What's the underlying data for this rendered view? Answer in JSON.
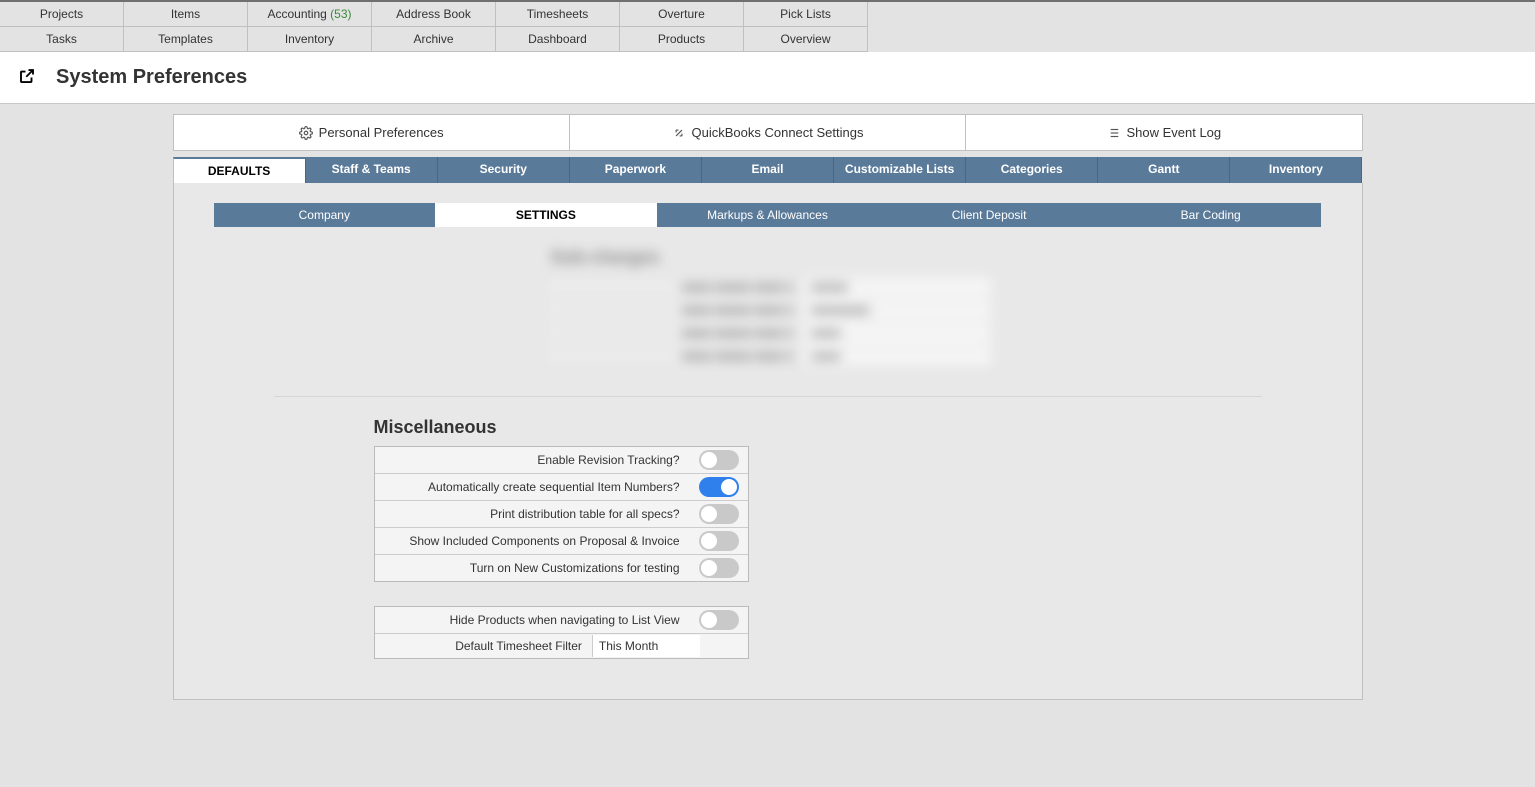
{
  "nav": {
    "row1": [
      "Projects",
      "Items",
      "Accounting",
      "Address Book",
      "Timesheets",
      "Overture",
      "Pick Lists"
    ],
    "row1_badge_index": 2,
    "row1_badge": "(53)",
    "row2": [
      "Tasks",
      "Templates",
      "Inventory",
      "Archive",
      "Dashboard",
      "Products",
      "Overview"
    ]
  },
  "page_title": "System Preferences",
  "top_buttons": {
    "personal": "Personal Preferences",
    "qb": "QuickBooks Connect Settings",
    "eventlog": "Show Event Log"
  },
  "primary_tabs": [
    "DEFAULTS",
    "Staff & Teams",
    "Security",
    "Paperwork",
    "Email",
    "Customizable Lists",
    "Categories",
    "Gantt",
    "Inventory"
  ],
  "primary_active": 0,
  "secondary_tabs": [
    "Company",
    "SETTINGS",
    "Markups & Allowances",
    "Client Deposit",
    "Bar Coding"
  ],
  "secondary_active": 1,
  "blurred_section_title": "Sub-charges",
  "miscellaneous": {
    "heading": "Miscellaneous",
    "toggles": [
      {
        "label": "Enable Revision Tracking?",
        "on": false
      },
      {
        "label": "Automatically create sequential Item Numbers?",
        "on": true
      },
      {
        "label": "Print distribution table for all specs?",
        "on": false
      },
      {
        "label": "Show Included Components on Proposal & Invoice",
        "on": false
      },
      {
        "label": "Turn on New Customizations for testing",
        "on": false
      }
    ],
    "extra_toggle": {
      "label": "Hide Products when navigating to List View",
      "on": false
    },
    "timesheet_filter_label": "Default Timesheet Filter",
    "timesheet_filter_value": "This Month"
  }
}
